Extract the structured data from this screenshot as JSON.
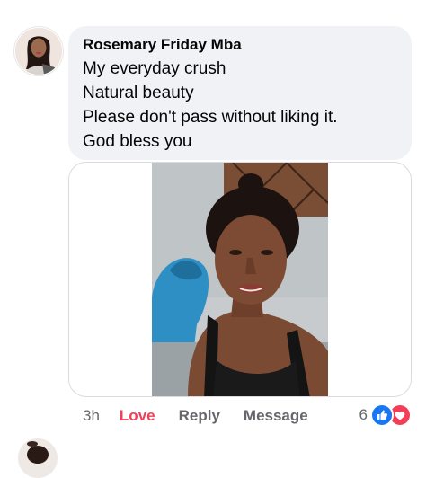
{
  "comment": {
    "author": "Rosemary Friday Mba",
    "lines": [
      "My everyday crush",
      "Natural beauty",
      "Please don't pass without liking it.",
      "God bless you"
    ],
    "attachment": {
      "type": "photo"
    }
  },
  "actions": {
    "time": "3h",
    "love_label": "Love",
    "reply_label": "Reply",
    "message_label": "Message"
  },
  "reactions": {
    "count": "6",
    "icons": [
      "like-icon",
      "love-icon"
    ]
  },
  "colors": {
    "bubble_bg": "#f0f2f5",
    "love_active": "#f33e58",
    "secondary_text": "#65676b",
    "like_blue": "#1877f2",
    "love_red": "#f33e58"
  }
}
